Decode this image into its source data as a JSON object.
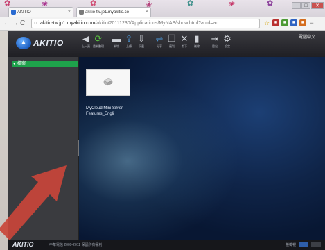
{
  "browser": {
    "tabs": [
      {
        "label": "AKITIO"
      },
      {
        "label": "akitio-tw.jp1.myakitio.co"
      }
    ],
    "url": {
      "host": "akitio-tw.jp1.myakitio.com",
      "path": "/akitio/20111230/Applications/MyNAS/show.html?auid=ad"
    },
    "window_buttons": [
      "—",
      "□",
      "✕"
    ],
    "tab_close": "×"
  },
  "app": {
    "logo_text": "AKITIO",
    "user_label": "電腦中文",
    "toolbar": [
      {
        "icon": "back-icon",
        "glyph": "◀",
        "label": "上一頁"
      },
      {
        "icon": "refresh-icon",
        "glyph": "⟳",
        "label": "重新整理"
      },
      {
        "icon": "folder-icon",
        "glyph": "▬",
        "label": "新增"
      },
      {
        "icon": "upload-icon",
        "glyph": "⇪",
        "label": "上傳"
      },
      {
        "icon": "download-icon",
        "glyph": "⇩",
        "label": "下載"
      },
      {
        "icon": "share-icon",
        "glyph": "⇌",
        "label": "分享"
      },
      {
        "icon": "copy-icon",
        "glyph": "❐",
        "label": "複製"
      },
      {
        "icon": "cut-icon",
        "glyph": "✕",
        "label": "剪下"
      },
      {
        "icon": "delete-icon",
        "glyph": "▮",
        "label": "刪除"
      },
      {
        "icon": "exit-icon",
        "glyph": "⇥",
        "label": "登出"
      },
      {
        "icon": "settings-icon",
        "glyph": "⚙",
        "label": "設定"
      }
    ]
  },
  "sidebar": {
    "items": [
      {
        "label": "檔案",
        "expanded": true
      }
    ]
  },
  "main": {
    "files": [
      {
        "name": "MyCloud Mini Silver Features_Engli",
        "icon": "drive-icon"
      }
    ]
  },
  "footer": {
    "logo": "AKITIO",
    "copyright": "中華電信 2009-2011 保留所有權利",
    "right_label": "一般檢視"
  },
  "colors": {
    "sidebar_selection": "#1ea24b",
    "header_bg": "#2b2b30",
    "main_bg": "#0f2448",
    "annotation_arrow": "#c9453a"
  }
}
